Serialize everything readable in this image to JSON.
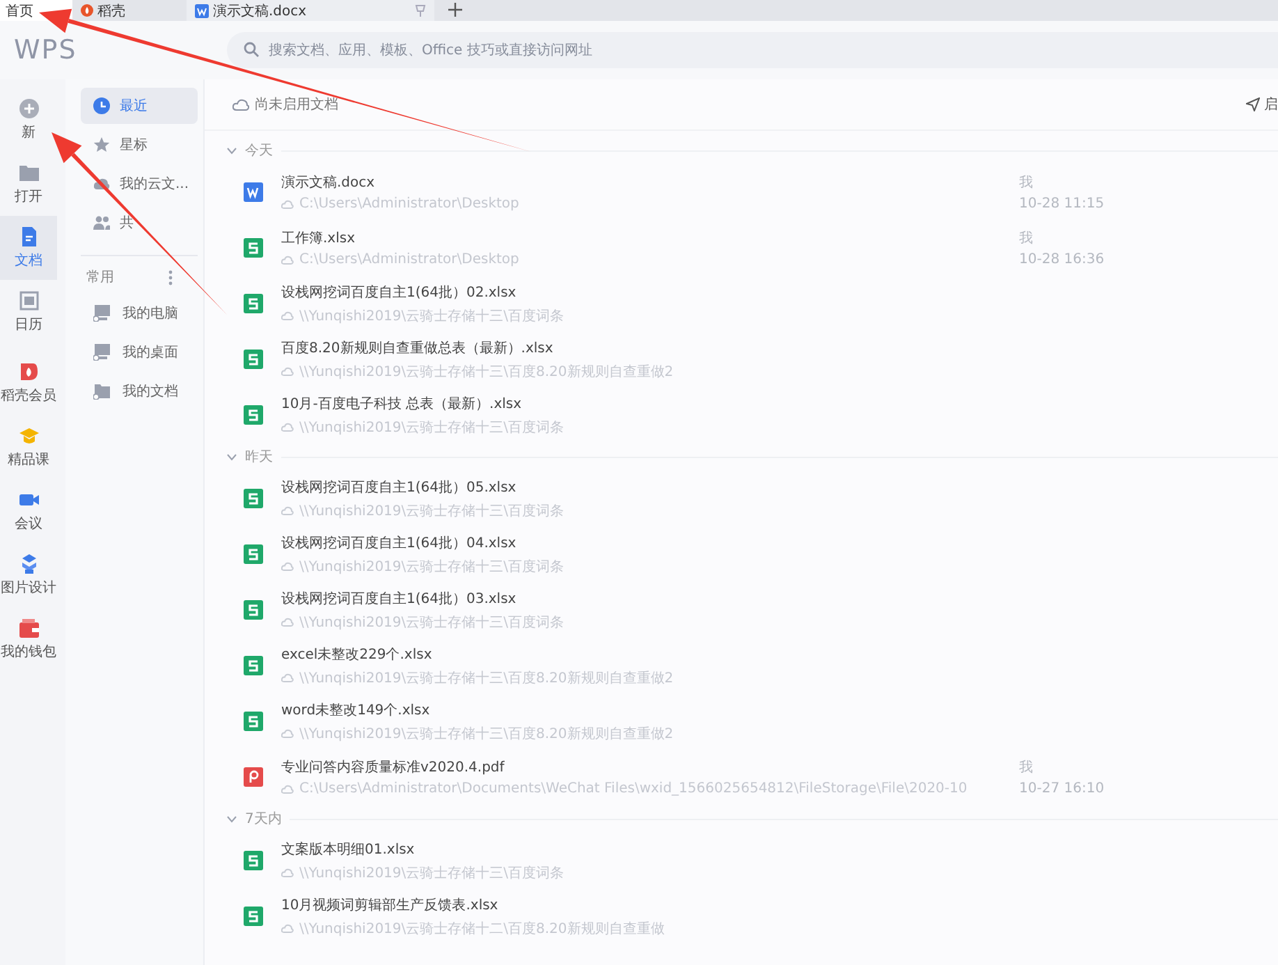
{
  "tabs": [
    {
      "label": "首页",
      "kind": "home",
      "selected": true
    },
    {
      "label": "稻壳",
      "kind": "docer",
      "selected": false
    },
    {
      "label": "演示文稿.docx",
      "kind": "writer",
      "selected": false
    }
  ],
  "header": {
    "logo": "WPS",
    "search": {
      "placeholder": "搜索文档、应用、模板、Office 技巧或直接访问网址"
    }
  },
  "rail": [
    {
      "label": "新",
      "kind": "new",
      "selected": false
    },
    {
      "label": "打开",
      "kind": "open",
      "selected": false
    },
    {
      "label": "文档",
      "kind": "doc",
      "selected": true
    },
    {
      "label": "日历",
      "kind": "calendar",
      "selected": false
    },
    {
      "label": "稻壳会员",
      "kind": "docer",
      "selected": false
    },
    {
      "label": "精品课",
      "kind": "course",
      "selected": false
    },
    {
      "label": "会议",
      "kind": "meeting",
      "selected": false
    },
    {
      "label": "图片设计",
      "kind": "design",
      "selected": false
    },
    {
      "label": "我的钱包",
      "kind": "wallet",
      "selected": false
    }
  ],
  "nav": {
    "items": [
      {
        "label": "最近",
        "kind": "clock",
        "selected": true
      },
      {
        "label": "星标",
        "kind": "star",
        "selected": false
      },
      {
        "label": "我的云文...",
        "kind": "cloud",
        "selected": false
      },
      {
        "label": "共",
        "kind": "people",
        "selected": false
      }
    ],
    "section": "常用",
    "places": [
      {
        "label": "我的电脑",
        "kind": "computer"
      },
      {
        "label": "我的桌面",
        "kind": "desktop"
      },
      {
        "label": "我的文档",
        "kind": "folder"
      }
    ]
  },
  "toolbar": {
    "sync": "尚未启用文档",
    "right": "启"
  },
  "groups": [
    {
      "title": "今天",
      "files": [
        {
          "kind": "w",
          "name": "演示文稿.docx",
          "path": "C:\\Users\\Administrator\\Desktop",
          "owner": "我",
          "time": "10-28 11:15"
        },
        {
          "kind": "s",
          "name": "工作簿.xlsx",
          "path": "C:\\Users\\Administrator\\Desktop",
          "owner": "我",
          "time": "10-28 16:36"
        },
        {
          "kind": "s",
          "name": "设栈网挖词百度自主1(64批）02.xlsx",
          "path": "\\\\Yunqishi2019\\云骑士存储十三\\百度词条"
        },
        {
          "kind": "s",
          "name": "百度8.20新规则自查重做总表（最新）.xlsx",
          "path": "\\\\Yunqishi2019\\云骑士存储十三\\百度8.20新规则自查重做2"
        },
        {
          "kind": "s",
          "name": "10月-百度电子科技 总表（最新）.xlsx",
          "path": "\\\\Yunqishi2019\\云骑士存储十三\\百度词条"
        }
      ]
    },
    {
      "title": "昨天",
      "files": [
        {
          "kind": "s",
          "name": "设栈网挖词百度自主1(64批）05.xlsx",
          "path": "\\\\Yunqishi2019\\云骑士存储十三\\百度词条"
        },
        {
          "kind": "s",
          "name": "设栈网挖词百度自主1(64批）04.xlsx",
          "path": "\\\\Yunqishi2019\\云骑士存储十三\\百度词条"
        },
        {
          "kind": "s",
          "name": "设栈网挖词百度自主1(64批）03.xlsx",
          "path": "\\\\Yunqishi2019\\云骑士存储十三\\百度词条"
        },
        {
          "kind": "s",
          "name": "excel未整改229个.xlsx",
          "path": "\\\\Yunqishi2019\\云骑士存储十三\\百度8.20新规则自查重做2"
        },
        {
          "kind": "s",
          "name": "word未整改149个.xlsx",
          "path": "\\\\Yunqishi2019\\云骑士存储十三\\百度8.20新规则自查重做2"
        },
        {
          "kind": "p",
          "name": "专业问答内容质量标准v2020.4.pdf",
          "path": "C:\\Users\\Administrator\\Documents\\WeChat Files\\wxid_1566025654812\\FileStorage\\File\\2020-10",
          "owner": "我",
          "time": "10-27 16:10"
        }
      ]
    },
    {
      "title": "7天内",
      "files": [
        {
          "kind": "s",
          "name": "文案版本明细01.xlsx",
          "path": "\\\\Yunqishi2019\\云骑士存储十三\\百度词条"
        },
        {
          "kind": "s",
          "name": "10月视频词剪辑部生产反馈表.xlsx",
          "path": "\\\\Yunqishi2019\\云骑士存储十二\\百度8.20新规则自查重做"
        }
      ]
    }
  ],
  "annotations": [
    {
      "kind": "arrow"
    },
    {
      "kind": "arrow"
    }
  ]
}
